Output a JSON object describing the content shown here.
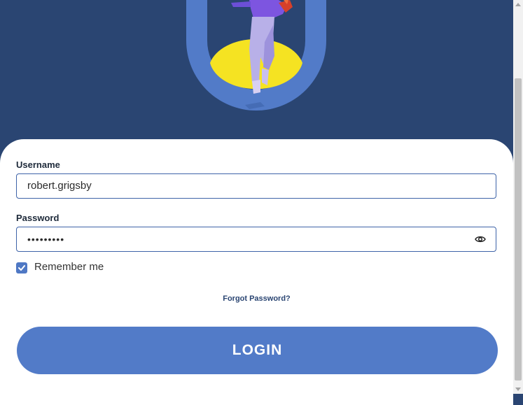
{
  "hero": {
    "illustration": "person-jumping-in-arch",
    "colors": {
      "background": "#2a4572",
      "arch": "#527bc8",
      "sun": "#f5e322"
    }
  },
  "form": {
    "username_label": "Username",
    "username_value": "robert.grigsby",
    "password_label": "Password",
    "password_value": "•••••••••",
    "remember_label": "Remember me",
    "remember_checked": true,
    "forgot_label": "Forgot Password?",
    "login_label": "LOGIN"
  },
  "icons": {
    "password_toggle": "eye-icon",
    "checkbox": "check-icon"
  },
  "colors": {
    "accent": "#527bc8",
    "border": "#3e63a8",
    "link": "#2a4572"
  }
}
